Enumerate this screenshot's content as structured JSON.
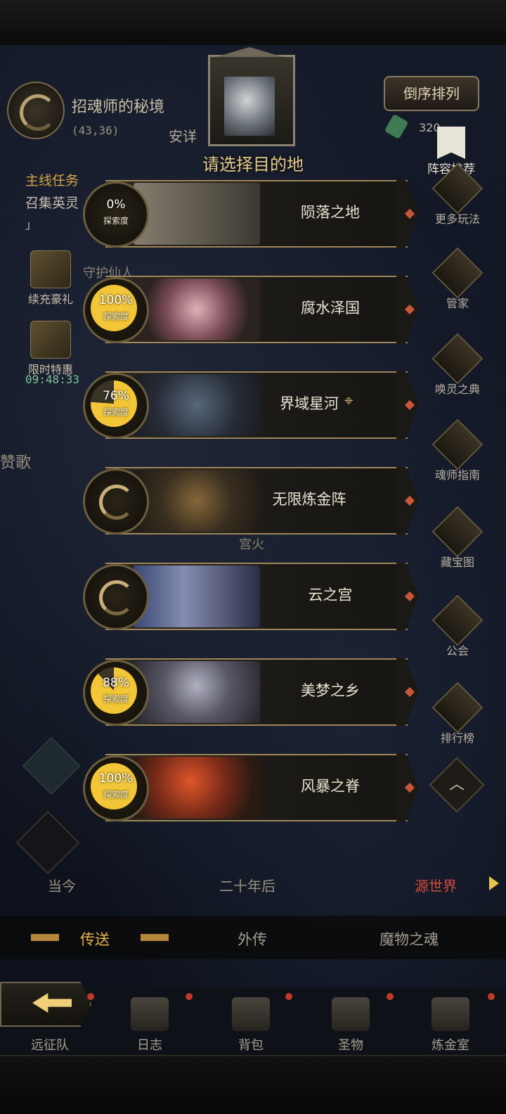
{
  "hud": {
    "location_name": "招魂师的秘境",
    "coords": "(43,36)",
    "partial_label": "安详",
    "quest_title": "主线任务",
    "quest_desc": "召集英灵",
    "quest_mark": "」",
    "recharge_label": "续充豪礼",
    "limited_label": "限时特惠",
    "limited_timer": "09:48:33",
    "frag_left": "赞歌",
    "frag_mid1": "守护仙人",
    "frag_mid2": "宫火"
  },
  "top_right": {
    "sort_label": "倒序排列",
    "gem_count": "320",
    "recommend_label": "阵容推荐"
  },
  "rail": [
    {
      "label": "更多玩法",
      "icon": "gift-icon"
    },
    {
      "label": "管家",
      "icon": "quill-icon"
    },
    {
      "label": "唤灵之典",
      "icon": "book-icon"
    },
    {
      "label": "魂师指南",
      "icon": "compass-icon"
    },
    {
      "label": "藏宝图",
      "icon": "scroll-icon"
    },
    {
      "label": "公会",
      "icon": "guild-crest-icon"
    },
    {
      "label": "排行榜",
      "icon": "trophy-icon"
    }
  ],
  "modal": {
    "title": "请选择目的地",
    "destinations": [
      {
        "name": "陨落之地",
        "progress": "0%",
        "progress_label": "探索度",
        "value": 0
      },
      {
        "name": "腐水泽国",
        "progress": "100%",
        "progress_label": "探索度",
        "value": 100
      },
      {
        "name": "界域星河",
        "progress": "76%",
        "progress_label": "探索度",
        "value": 76,
        "current": true
      },
      {
        "name": "无限炼金阵",
        "progress": "",
        "progress_label": "",
        "value": null
      },
      {
        "name": "云之宫",
        "progress": "",
        "progress_label": "",
        "value": null
      },
      {
        "name": "美梦之乡",
        "progress": "88%",
        "progress_label": "探索度",
        "value": 88
      },
      {
        "name": "风暴之脊",
        "progress": "100%",
        "progress_label": "探索度",
        "value": 100
      }
    ]
  },
  "era": {
    "left": "当今",
    "mid": "二十年后",
    "right": "源世界"
  },
  "tabs": {
    "teleport": "传送",
    "side_story": "外传",
    "monster_soul": "魔物之魂"
  },
  "nav": {
    "expedition": "远征队",
    "journal": "日志",
    "bag": "背包",
    "relic": "圣物",
    "alchemy": "炼金室"
  },
  "colors": {
    "accent_gold": "#e6ca8a",
    "progress_gold": "#f2c636",
    "era_active": "#d04b3c"
  }
}
